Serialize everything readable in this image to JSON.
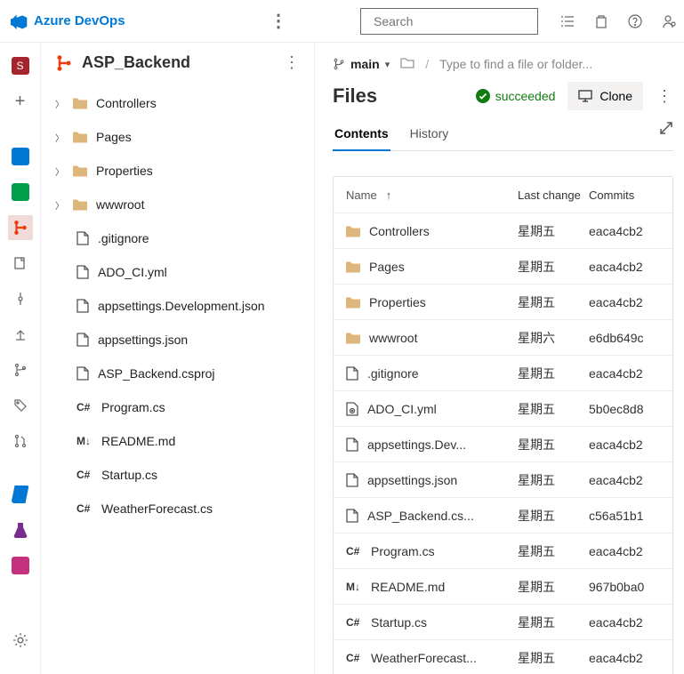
{
  "top": {
    "brand": "Azure DevOps",
    "search_placeholder": "Search"
  },
  "project": {
    "name": "ASP_Backend"
  },
  "tree": [
    {
      "type": "folder",
      "name": "Controllers",
      "expandable": true
    },
    {
      "type": "folder",
      "name": "Pages",
      "expandable": true
    },
    {
      "type": "folder",
      "name": "Properties",
      "expandable": true
    },
    {
      "type": "folder",
      "name": "wwwroot",
      "expandable": true
    },
    {
      "type": "file",
      "name": ".gitignore",
      "icon": "file"
    },
    {
      "type": "file",
      "name": "ADO_CI.yml",
      "icon": "file"
    },
    {
      "type": "file",
      "name": "appsettings.Development.json",
      "icon": "file"
    },
    {
      "type": "file",
      "name": "appsettings.json",
      "icon": "file"
    },
    {
      "type": "file",
      "name": "ASP_Backend.csproj",
      "icon": "file"
    },
    {
      "type": "file",
      "name": "Program.cs",
      "icon": "cs"
    },
    {
      "type": "file",
      "name": "README.md",
      "icon": "md"
    },
    {
      "type": "file",
      "name": "Startup.cs",
      "icon": "cs"
    },
    {
      "type": "file",
      "name": "WeatherForecast.cs",
      "icon": "cs"
    }
  ],
  "branch": {
    "name": "main"
  },
  "path_hint": "Type to find a file or folder...",
  "page_title": "Files",
  "build_status": "succeeded",
  "clone_label": "Clone",
  "tabs": {
    "contents": "Contents",
    "history": "History"
  },
  "columns": {
    "name": "Name",
    "change": "Last change",
    "commits": "Commits"
  },
  "rows": [
    {
      "icon": "folder",
      "name": "Controllers",
      "change": "星期五",
      "commit": "eaca4cb2"
    },
    {
      "icon": "folder",
      "name": "Pages",
      "change": "星期五",
      "commit": "eaca4cb2"
    },
    {
      "icon": "folder",
      "name": "Properties",
      "change": "星期五",
      "commit": "eaca4cb2"
    },
    {
      "icon": "folder",
      "name": "wwwroot",
      "change": "星期六",
      "commit": "e6db649c"
    },
    {
      "icon": "file",
      "name": ".gitignore",
      "change": "星期五",
      "commit": "eaca4cb2"
    },
    {
      "icon": "yml",
      "name": "ADO_CI.yml",
      "change": "星期五",
      "commit": "5b0ec8d8"
    },
    {
      "icon": "file",
      "name": "appsettings.Dev...",
      "change": "星期五",
      "commit": "eaca4cb2"
    },
    {
      "icon": "file",
      "name": "appsettings.json",
      "change": "星期五",
      "commit": "eaca4cb2"
    },
    {
      "icon": "file",
      "name": "ASP_Backend.cs...",
      "change": "星期五",
      "commit": "c56a51b1"
    },
    {
      "icon": "cs",
      "name": "Program.cs",
      "change": "星期五",
      "commit": "eaca4cb2"
    },
    {
      "icon": "md",
      "name": "README.md",
      "change": "星期五",
      "commit": "967b0ba0"
    },
    {
      "icon": "cs",
      "name": "Startup.cs",
      "change": "星期五",
      "commit": "eaca4cb2"
    },
    {
      "icon": "cs",
      "name": "WeatherForecast...",
      "change": "星期五",
      "commit": "eaca4cb2"
    }
  ]
}
